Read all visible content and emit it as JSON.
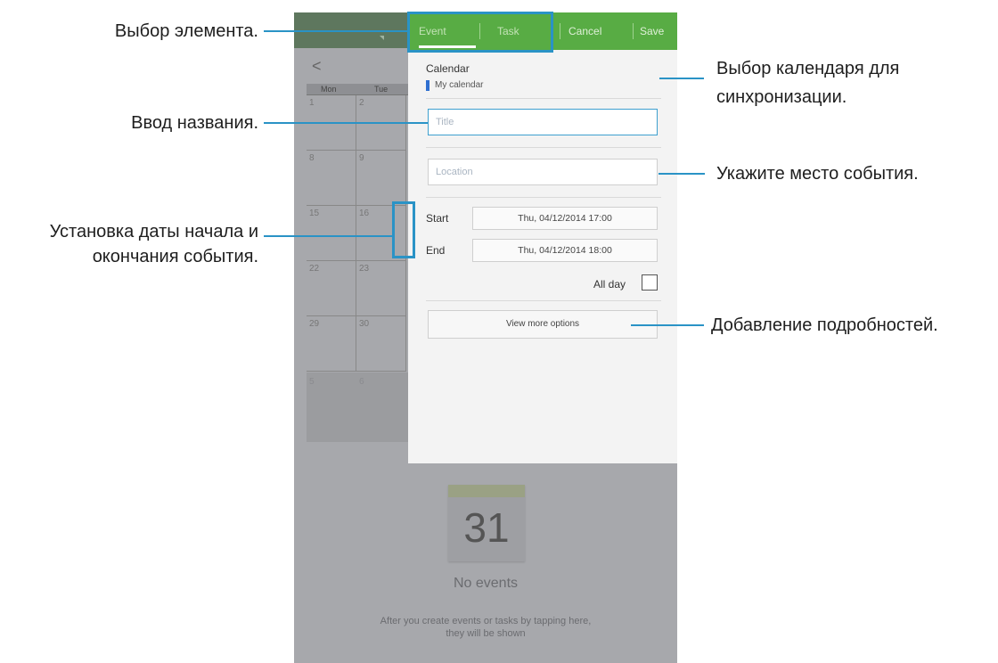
{
  "calendar_bg": {
    "weekday_headers": [
      "Mon",
      "Tue"
    ],
    "week_rows": [
      [
        "1",
        "2"
      ],
      [
        "8",
        "9"
      ],
      [
        "15",
        "16"
      ],
      [
        "22",
        "23"
      ],
      [
        "29",
        "30"
      ]
    ],
    "faded_row": [
      "5",
      "6"
    ]
  },
  "no_events": {
    "day": "31",
    "title": "No events",
    "description": "After you create events or tasks by tapping here, they will be shown"
  },
  "tabs": {
    "event": "Event",
    "task": "Task"
  },
  "actions": {
    "cancel": "Cancel",
    "save": "Save"
  },
  "calendar_section": {
    "label": "Calendar",
    "value": "My calendar"
  },
  "title_field": {
    "placeholder": "Title"
  },
  "location_field": {
    "placeholder": "Location"
  },
  "start": {
    "label": "Start",
    "value": "Thu, 04/12/2014  17:00"
  },
  "end": {
    "label": "End",
    "value": "Thu, 04/12/2014  18:00"
  },
  "all_day": {
    "label": "All day",
    "checked": false
  },
  "more_options": {
    "label": "View more options"
  },
  "callouts": {
    "select_item": "Выбор элемента.",
    "enter_title": "Ввод названия.",
    "set_dates_1": "Установка даты начала и",
    "set_dates_2": "окончания события.",
    "select_calendar_1": "Выбор календаря для",
    "select_calendar_2": "синхронизации.",
    "set_location": "Укажите место события.",
    "add_details": "Добавление подробностей."
  },
  "colors": {
    "accent": "#58ac44",
    "highlight": "#2a93c6"
  }
}
